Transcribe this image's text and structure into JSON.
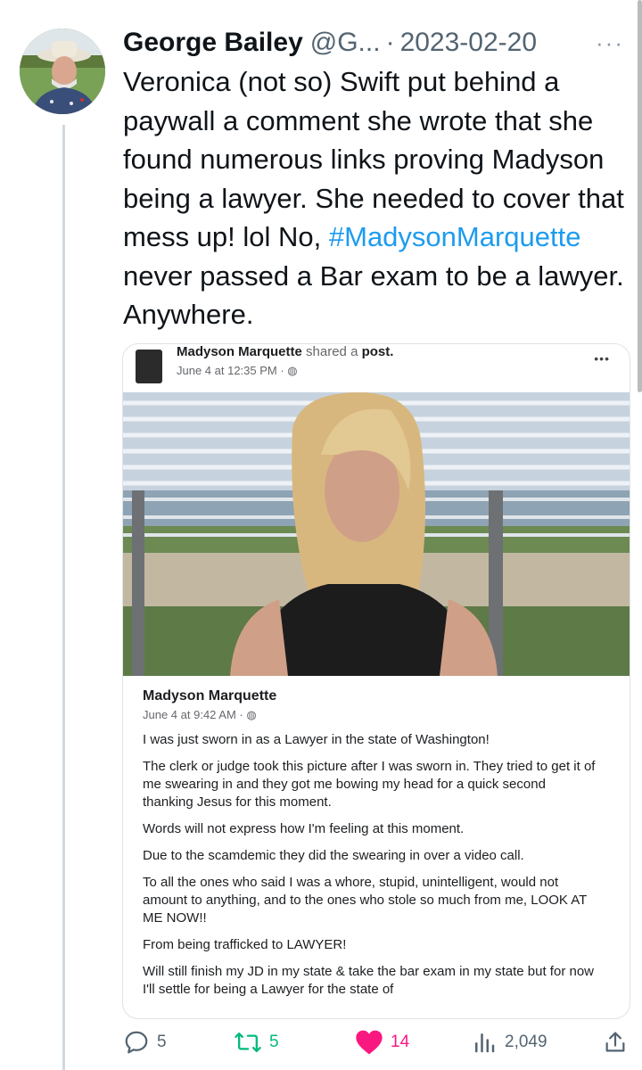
{
  "tweet": {
    "author_name": "George Bailey",
    "handle": "@G...",
    "separator": "·",
    "date": "2023-02-20",
    "more_label": "···",
    "text_parts": [
      "Veronica (not so) Swift put behind a paywall a comment she wrote that she found numerous links proving Madyson being a lawyer.  She needed to cover that mess up! lol  No, ",
      "#MadysonMarquette",
      " never passed a Bar exam to be a lawyer.  Anywhere."
    ]
  },
  "embedded_post": {
    "sharer": "Madyson Marquette",
    "shared_label": "shared a",
    "post_label": "post.",
    "time": "June 4 at 12:35 PM · ",
    "more_label": "•••",
    "inner_author": "Madyson Marquette",
    "inner_time": "June 4 at 9:42 AM · ",
    "paragraphs": [
      "I was just sworn in as a Lawyer in the state of Washington!",
      "The clerk or judge took this picture after I was sworn in. They tried to get it of me swearing in and they got me bowing my head for a quick second thanking Jesus for this moment.",
      "Words will not express how I'm feeling at this moment.",
      "Due to the scamdemic they did the swearing in over a video call.",
      "To all the ones who said I was a whore, stupid, unintelligent, would not amount to anything, and to the ones who stole so much from me, LOOK AT ME NOW!!",
      "From being trafficked to LAWYER!",
      "Will still finish my JD in my state & take the bar exam in my state but for now I'll settle for being a Lawyer for the state of"
    ]
  },
  "actions": {
    "replies": "5",
    "retweets": "5",
    "likes": "14",
    "views": "2,049"
  },
  "colors": {
    "link": "#1d9bf0",
    "like": "#f91880",
    "retweet": "#00ba7c",
    "muted": "#536471"
  }
}
